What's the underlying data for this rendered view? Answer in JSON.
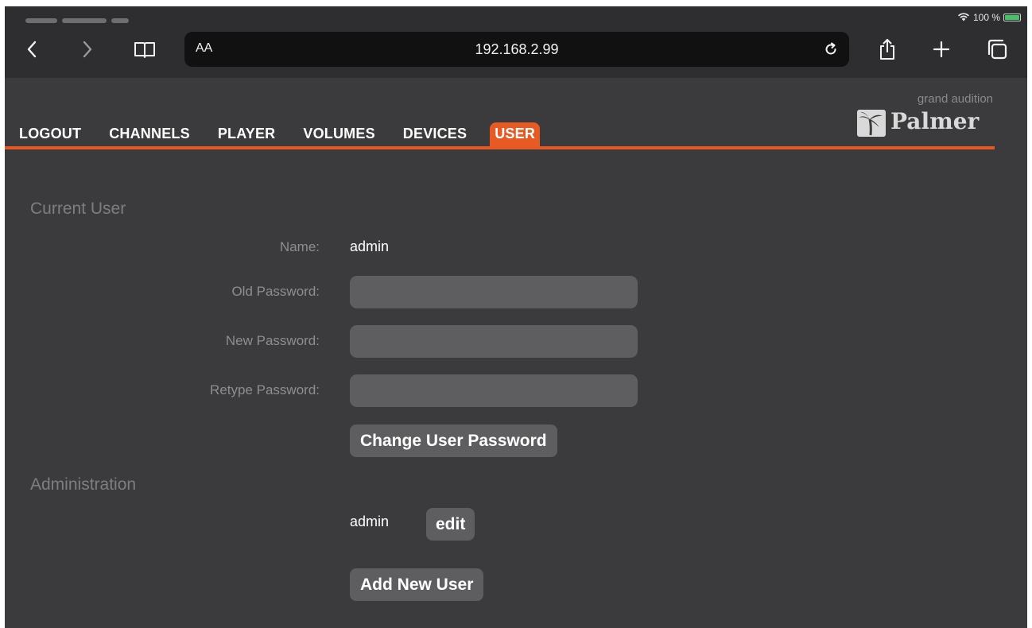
{
  "statusbar": {
    "battery_percent": "100 %",
    "battery_level": 1.0
  },
  "browser": {
    "text_size_label": "AA",
    "url": "192.168.2.99",
    "icons": {
      "back": "chevron-left-icon",
      "forward": "chevron-right-icon",
      "bookmarks": "book-icon",
      "reload": "reload-icon",
      "share": "share-icon",
      "new_tab": "plus-icon",
      "tabs": "tabs-icon"
    }
  },
  "nav": {
    "items": [
      {
        "label": "LOGOUT"
      },
      {
        "label": "CHANNELS"
      },
      {
        "label": "PLAYER"
      },
      {
        "label": "VOLUMES"
      },
      {
        "label": "DEVICES"
      },
      {
        "label": "USER"
      }
    ],
    "active": "USER"
  },
  "logo": {
    "subtitle": "grand audition",
    "brand": "Palmer",
    "mark": "palm-tree-icon"
  },
  "current_user": {
    "title": "Current User",
    "name_label": "Name:",
    "name_value": "admin",
    "old_password_label": "Old Password:",
    "old_password_value": "",
    "new_password_label": "New Password:",
    "new_password_value": "",
    "retype_password_label": "Retype Password:",
    "retype_password_value": "",
    "change_button": "Change User Password"
  },
  "administration": {
    "title": "Administration",
    "users": [
      {
        "name": "admin",
        "edit_label": "edit"
      }
    ],
    "add_button": "Add New User"
  },
  "colors": {
    "accent": "#e85a24",
    "background": "#3b3b3d",
    "field": "#5e5e61",
    "chrome": "#2e2e30"
  }
}
